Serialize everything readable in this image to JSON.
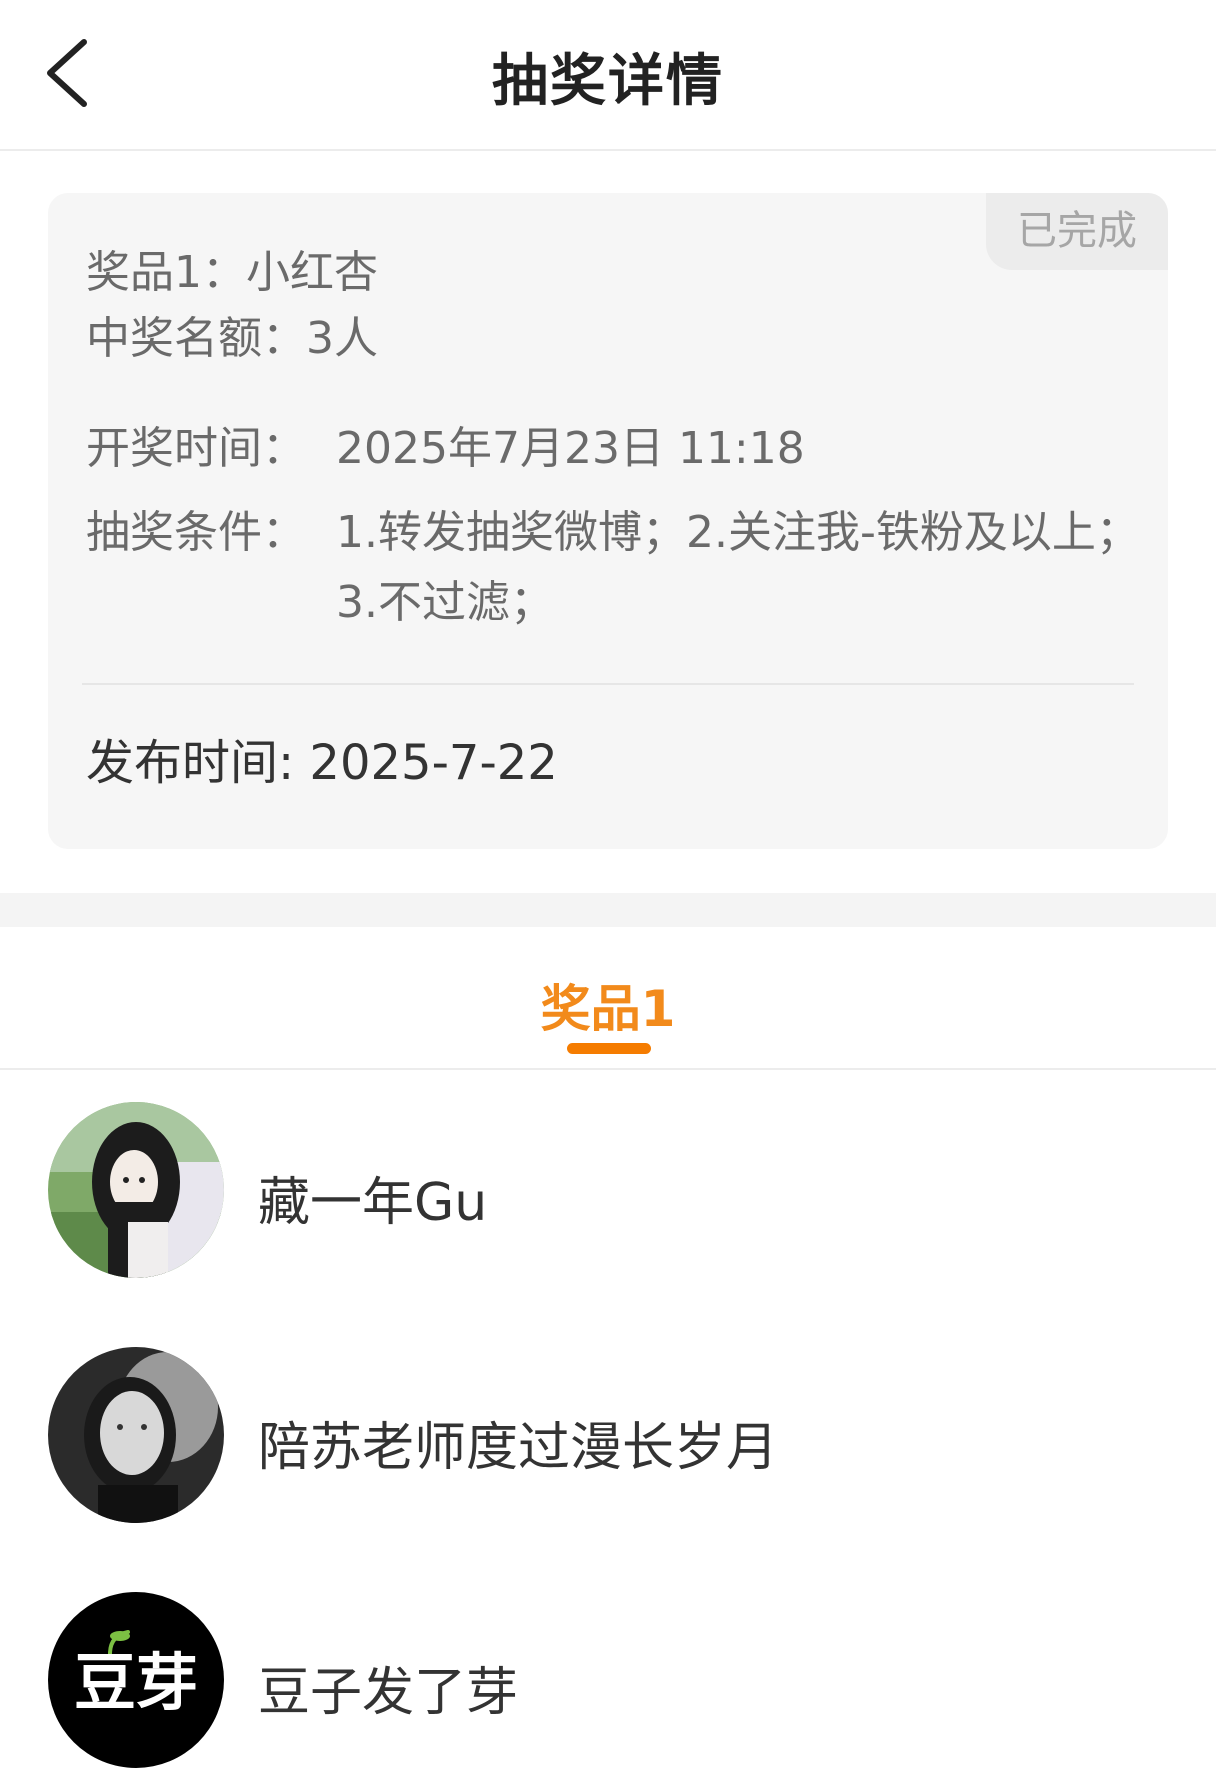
{
  "header": {
    "title": "抽奖详情",
    "back_icon": "chevron-left-icon"
  },
  "card": {
    "status": "已完成",
    "prize_line": "奖品1：小红杏",
    "quota_line": "中奖名额：3人",
    "draw_time_label": "开奖时间：",
    "draw_time_value": "2025年7月23日 11:18",
    "conditions_label": "抽奖条件：",
    "conditions_value": "1.转发抽奖微博；2.关注我-铁粉及以上；3.不过滤；",
    "publish_time": "发布时间: 2025-7-22"
  },
  "tabs": [
    {
      "label": "奖品1",
      "active": true
    }
  ],
  "winners": [
    {
      "name": "藏一年Gu"
    },
    {
      "name": "陪苏老师度过漫长岁月"
    },
    {
      "name": "豆子发了芽",
      "avatar_text": "豆芽"
    }
  ],
  "colors": {
    "accent": "#f28a1b",
    "card_bg": "#f6f6f6",
    "badge_bg": "#ececec",
    "badge_text": "#a6a6a6"
  }
}
